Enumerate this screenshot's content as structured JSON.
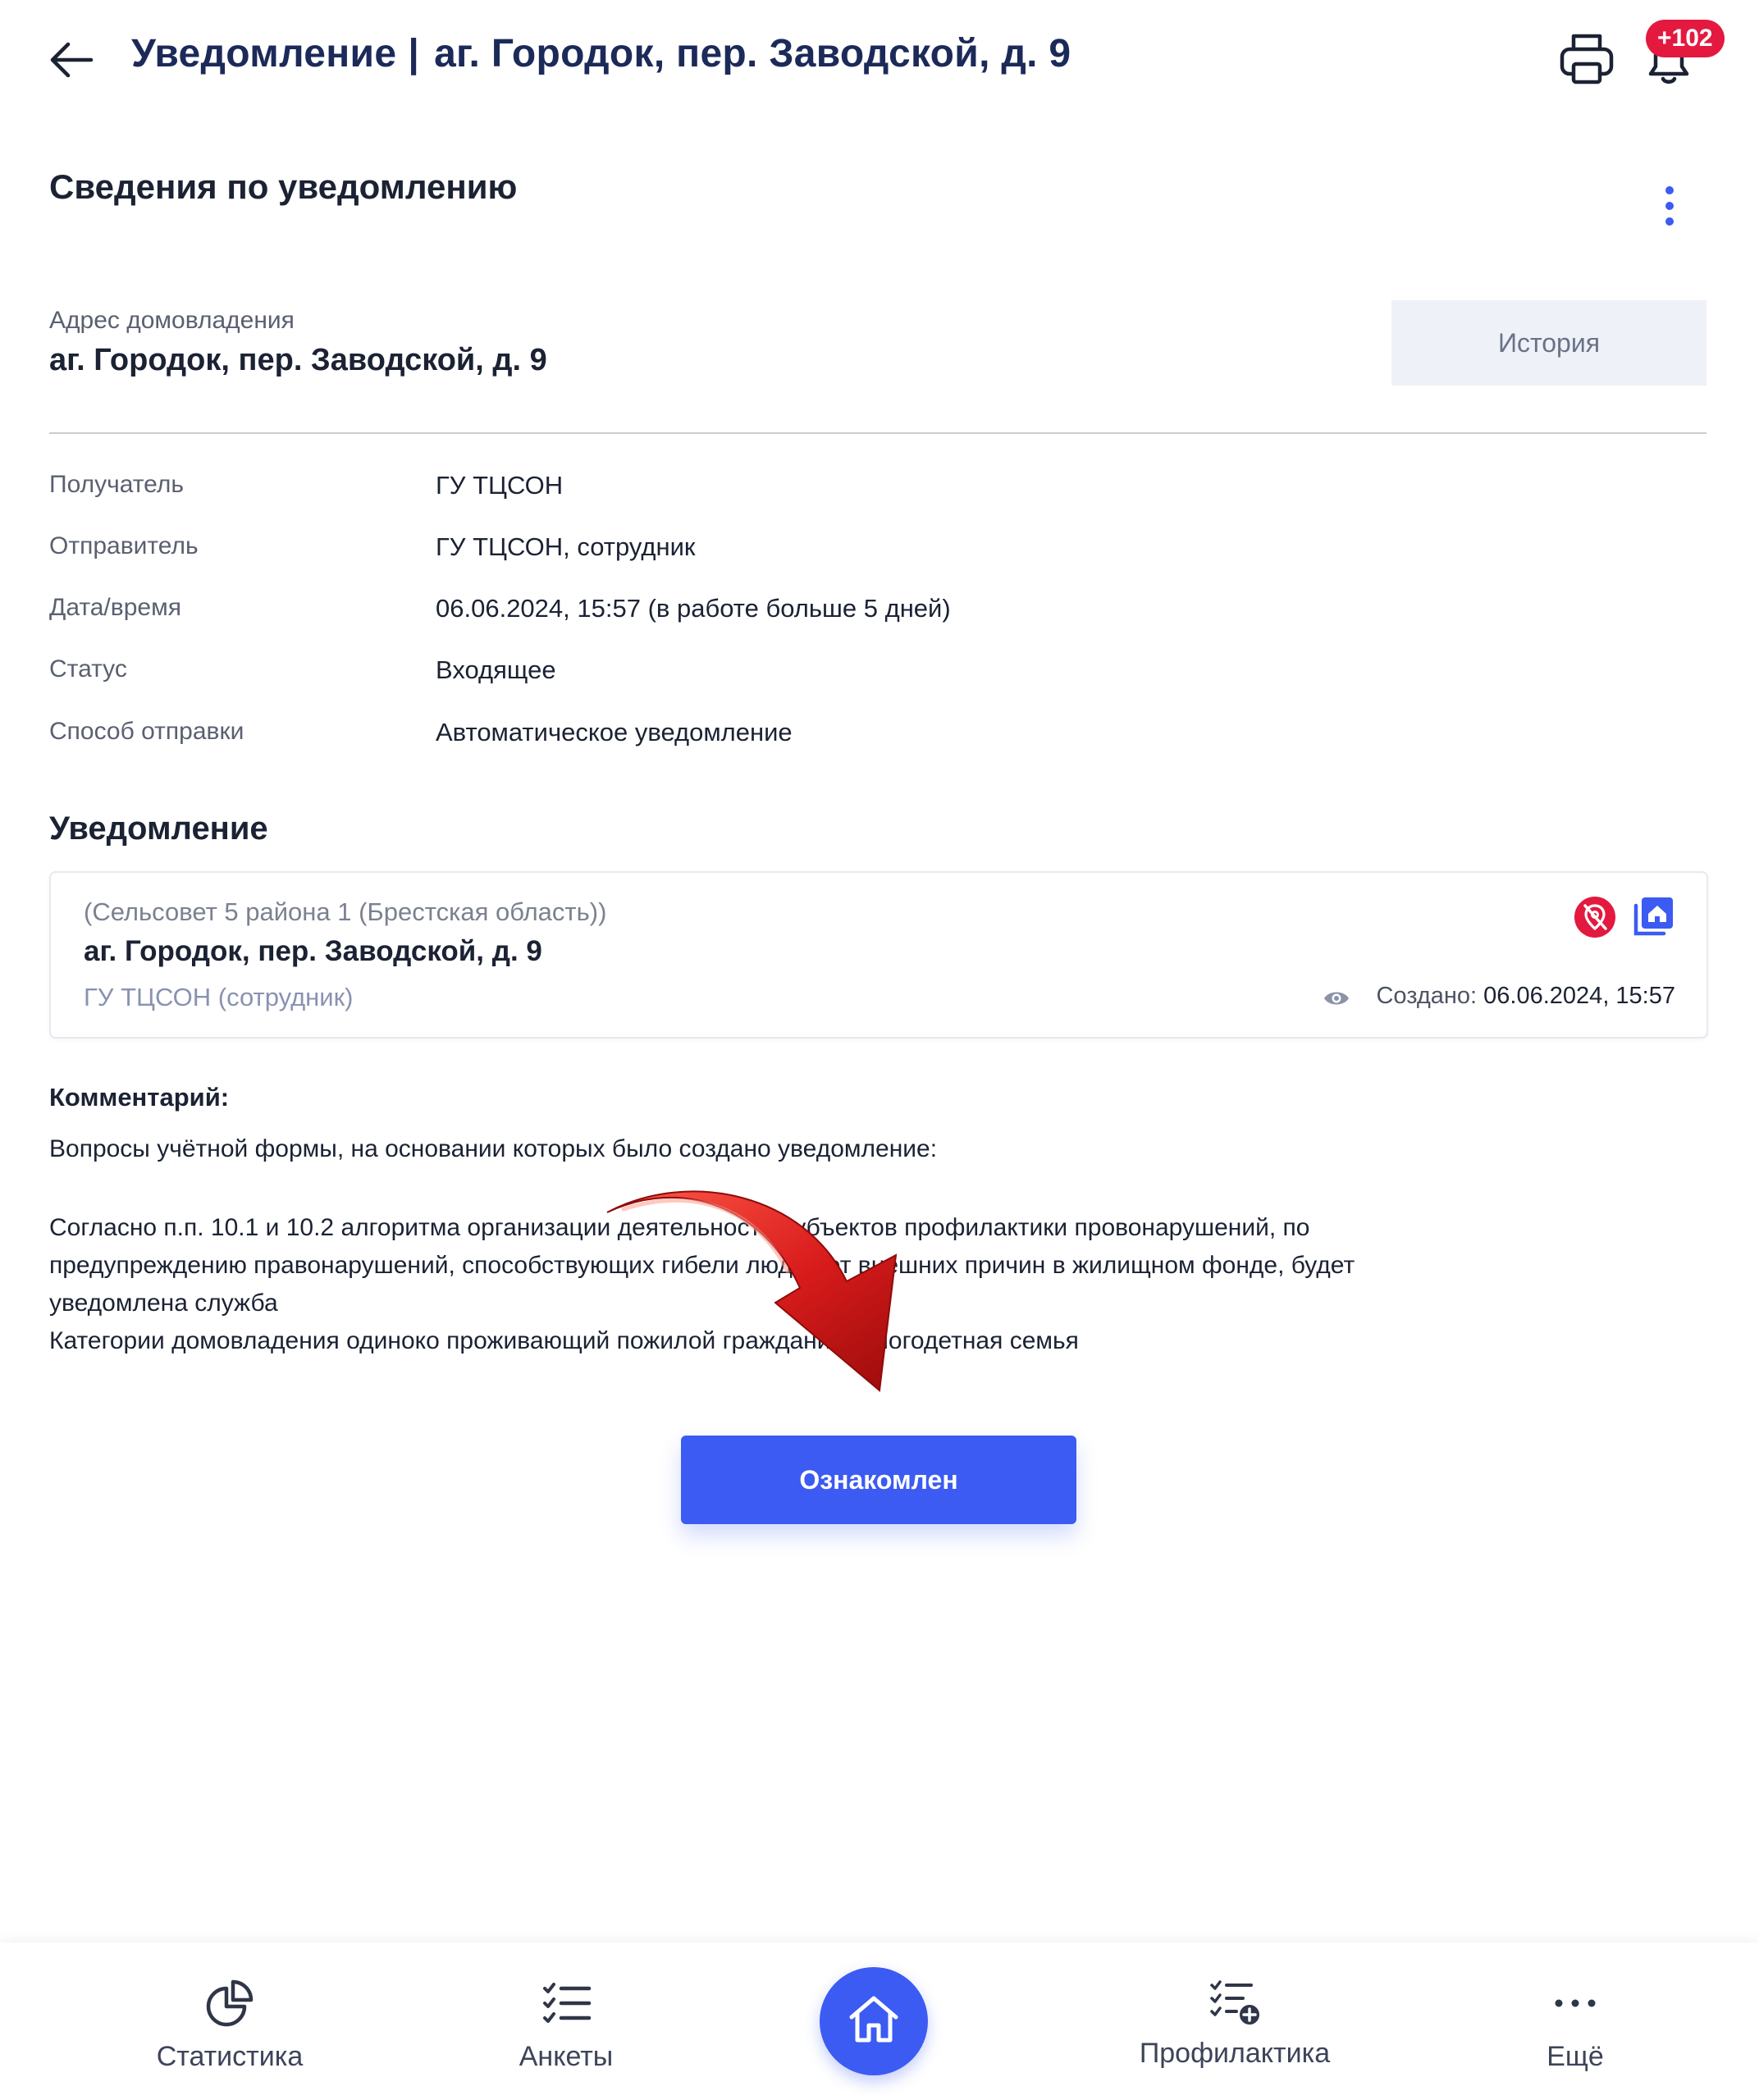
{
  "header": {
    "title": "Уведомление",
    "separator": "|",
    "address": "аг. Городок, пер. Заводской, д. 9",
    "notification_count": "+102"
  },
  "section": {
    "title": "Сведения по уведомлению"
  },
  "household": {
    "label": "Адрес домовладения",
    "address": "аг. Городок, пер. Заводской, д. 9",
    "history_button": "История"
  },
  "details": [
    {
      "label": "Получатель",
      "value": "ГУ ТЦСОН"
    },
    {
      "label": "Отправитель",
      "value": "ГУ ТЦСОН, сотрудник"
    },
    {
      "label": "Дата/время",
      "value": "06.06.2024, 15:57 (в работе больше 5 дней)"
    },
    {
      "label": "Статус",
      "value": "Входящее"
    },
    {
      "label": "Способ отправки",
      "value": "Автоматическое уведомление"
    }
  ],
  "notification": {
    "title": "Уведомление",
    "org": "(Сельсовет 5 района 1 (Брестская область))",
    "address": "аг. Городок, пер. Заводской, д. 9",
    "sender": "ГУ ТЦСОН (сотрудник)",
    "created_label": "Создано:",
    "created_value": "06.06.2024, 15:57"
  },
  "comment": {
    "label": "Комментарий:",
    "intro": "Вопросы учётной формы, на основании которых было создано уведомление:",
    "body": "Согласно п.п. 10.1 и 10.2 алгоритма организации деятельности субъектов профилактики провонарушений, по\nпредупреждению правонарушений, способствующих гибели людей от внешних причин в жилищном фонде, будет\nуведомлена служба\nКатегории домовладения одиноко проживающий пожилой гражданин, многодетная семья"
  },
  "actions": {
    "acknowledge": "Ознакомлен"
  },
  "nav": {
    "items": [
      {
        "label": "Статистика",
        "icon": "pie-chart-icon"
      },
      {
        "label": "Анкеты",
        "icon": "checklist-icon"
      },
      {
        "label": "",
        "icon": "home-icon"
      },
      {
        "label": "Профилактика",
        "icon": "checklist-add-icon"
      },
      {
        "label": "Ещё",
        "icon": "more-horizontal-icon"
      }
    ]
  },
  "colors": {
    "primary": "#3b5bf2",
    "badge": "#e3193f",
    "title": "#1c2a59",
    "arrow": "#d21e1e"
  }
}
